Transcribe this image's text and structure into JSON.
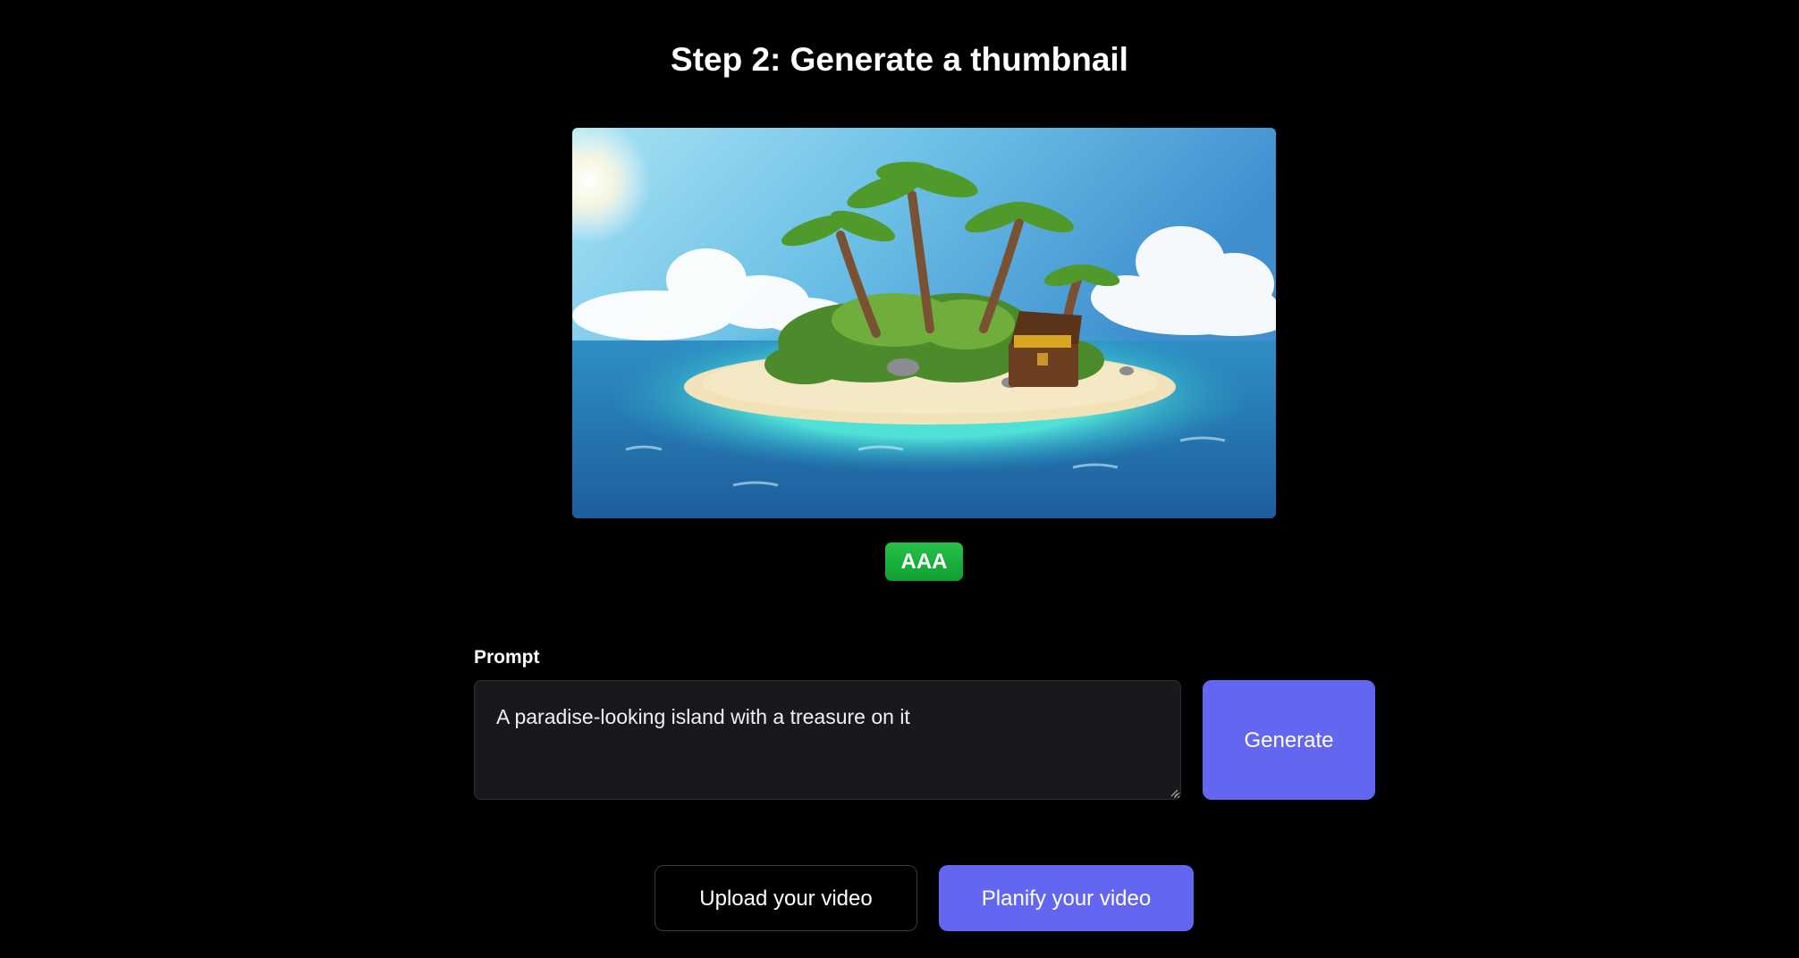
{
  "header": {
    "title": "Step 2: Generate a thumbnail"
  },
  "thumbnail": {
    "alt": "island-with-treasure-illustration",
    "badge": "AAA"
  },
  "prompt": {
    "label": "Prompt",
    "value": "A paradise-looking island with a treasure on it"
  },
  "actions": {
    "generate_label": "Generate",
    "upload_label": "Upload your video",
    "planify_label": "Planify your video"
  },
  "colors": {
    "accent": "#6366f1",
    "badge": "#1fb33f",
    "background": "#000000",
    "input_bg": "#18191d"
  }
}
